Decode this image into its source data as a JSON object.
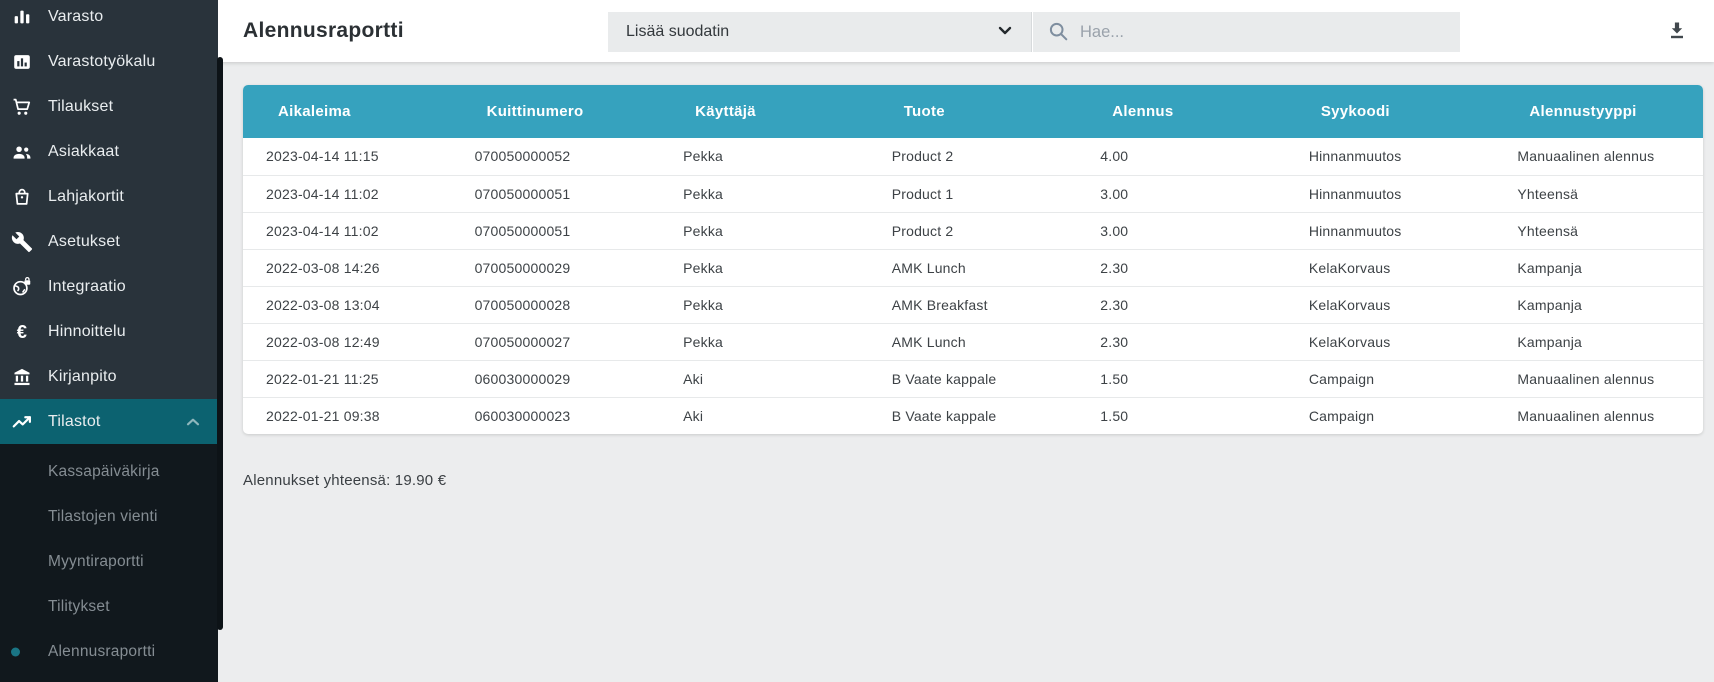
{
  "sidebar": {
    "colors": {
      "background": "#29333b",
      "submenu_background": "#11181d",
      "active_background": "#0c6270",
      "text": "#e9edef",
      "submenu_text": "#858d93",
      "active_dot": "#1a7585"
    },
    "items": [
      {
        "label": "Varasto",
        "icon": "bar-chart"
      },
      {
        "label": "Varastotyökalu",
        "icon": "box-chart"
      },
      {
        "label": "Tilaukset",
        "icon": "cart"
      },
      {
        "label": "Asiakkaat",
        "icon": "people"
      },
      {
        "label": "Lahjakortit",
        "icon": "gift-bag"
      },
      {
        "label": "Asetukset",
        "icon": "wrench"
      },
      {
        "label": "Integraatio",
        "icon": "globe-lock"
      },
      {
        "label": "Hinnoittelu",
        "icon": "euro"
      },
      {
        "label": "Kirjanpito",
        "icon": "bank"
      },
      {
        "label": "Tilastot",
        "icon": "trend-line",
        "active": true,
        "expanded": true
      }
    ],
    "submenu": [
      {
        "label": "Kassapäiväkirja"
      },
      {
        "label": "Tilastojen vienti"
      },
      {
        "label": "Myyntiraportti"
      },
      {
        "label": "Tilitykset"
      },
      {
        "label": "Alennusraportti",
        "active": true
      }
    ]
  },
  "topbar": {
    "title": "Alennusraportti",
    "filter_dropdown": {
      "label": "Lisää suodatin",
      "icon": "chevron-down"
    },
    "search": {
      "placeholder": "Hae...",
      "icon": "magnifier"
    },
    "download_icon": "download"
  },
  "report": {
    "header_color": "#36a2be",
    "columns": [
      "Aikaleima",
      "Kuittinumero",
      "Käyttäjä",
      "Tuote",
      "Alennus",
      "Syykoodi",
      "Alennustyyppi"
    ],
    "rows": [
      [
        "2023-04-14 11:15",
        "070050000052",
        "Pekka",
        "Product 2",
        "4.00",
        "Hinnanmuutos",
        "Manuaalinen alennus"
      ],
      [
        "2023-04-14 11:02",
        "070050000051",
        "Pekka",
        "Product 1",
        "3.00",
        "Hinnanmuutos",
        "Yhteensä"
      ],
      [
        "2023-04-14 11:02",
        "070050000051",
        "Pekka",
        "Product 2",
        "3.00",
        "Hinnanmuutos",
        "Yhteensä"
      ],
      [
        "2022-03-08 14:26",
        "070050000029",
        "Pekka",
        "AMK Lunch",
        "2.30",
        "KelaKorvaus",
        "Kampanja"
      ],
      [
        "2022-03-08 13:04",
        "070050000028",
        "Pekka",
        "AMK Breakfast",
        "2.30",
        "KelaKorvaus",
        "Kampanja"
      ],
      [
        "2022-03-08 12:49",
        "070050000027",
        "Pekka",
        "AMK Lunch",
        "2.30",
        "KelaKorvaus",
        "Kampanja"
      ],
      [
        "2022-01-21 11:25",
        "060030000029",
        "Aki",
        "B Vaate kappale",
        "1.50",
        "Campaign",
        "Manuaalinen alennus"
      ],
      [
        "2022-01-21 09:38",
        "060030000023",
        "Aki",
        "B Vaate kappale",
        "1.50",
        "Campaign",
        "Manuaalinen alennus"
      ]
    ],
    "total": "Alennukset yhteensä: 19.90 €"
  }
}
